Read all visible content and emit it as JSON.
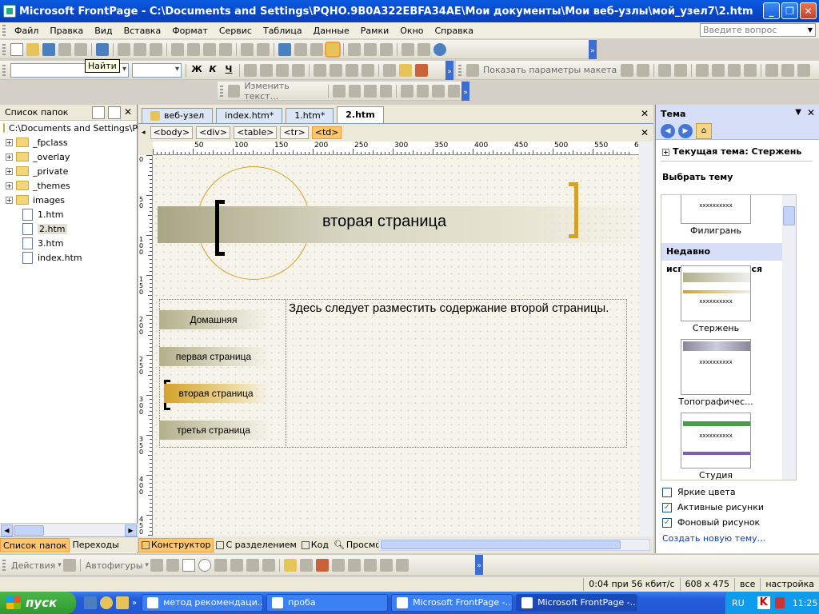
{
  "window": {
    "title": "Microsoft FrontPage - C:\\Documents and Settings\\PQHO.9B0A322EBFA34AE\\Мои документы\\Мои веб-узлы\\мой_узел7\\2.htm"
  },
  "menu": [
    "Файл",
    "Правка",
    "Вид",
    "Вставка",
    "Формат",
    "Сервис",
    "Таблица",
    "Данные",
    "Рамки",
    "Окно",
    "Справка"
  ],
  "ask_placeholder": "Введите вопрос",
  "tooltip": "Найти",
  "toolbar": {
    "bold": "Ж",
    "italic": "К",
    "underline": "Ч",
    "show_layout": "Показать параметры макета",
    "edit_text": "Изменить текст..."
  },
  "folder_list": {
    "title": "Список папок",
    "root": "C:\\Documents and Settings\\PQ",
    "folders": [
      "_fpclass",
      "_overlay",
      "_private",
      "_themes",
      "images"
    ],
    "files": [
      "1.htm",
      "2.htm",
      "3.htm",
      "index.htm"
    ],
    "selected": "2.htm"
  },
  "left_tabs": {
    "folders": "Список папок",
    "navigation": "Переходы"
  },
  "doc_tabs": [
    "веб-узел",
    "index.htm*",
    "1.htm*",
    "2.htm"
  ],
  "active_doc": "2.htm",
  "quick_tags": [
    "<body>",
    "<div>",
    "<table>",
    "<tr>",
    "<td>"
  ],
  "ruler_labels": [
    "50",
    "100",
    "150",
    "200",
    "250",
    "300",
    "350",
    "400",
    "450",
    "500",
    "550",
    "60"
  ],
  "vruler_labels": [
    "0",
    "5 0",
    "1 0 0",
    "1 5 0",
    "2 0 0",
    "2 5 0",
    "3 0 0",
    "3 5 0",
    "4 0 0",
    "4 5 0"
  ],
  "page": {
    "banner": "вторая страница",
    "nav": [
      "Домашняя",
      "первая страница",
      "вторая страница",
      "третья страница"
    ],
    "nav_active_index": 2,
    "body_text": "Здесь следует разместить содержание второй страницы."
  },
  "view_tabs": {
    "design": "Конструктор",
    "split": "С разделением",
    "code": "Код",
    "preview": "Просмотр"
  },
  "theme_pane": {
    "title": "Тема",
    "current_theme": "Текущая тема: Стержень",
    "select_theme": "Выбрать тему",
    "filigree": "Филигрань",
    "recent_header": "Недавно использовавшиеся",
    "themes": [
      "Стержень",
      "Топографичес...",
      "Студия"
    ],
    "thumb_placeholder": "xxxxxxxxxx",
    "options": [
      {
        "label": "Яркие цвета",
        "checked": false
      },
      {
        "label": "Активные рисунки",
        "checked": true
      },
      {
        "label": "Фоновый рисунок",
        "checked": true
      }
    ],
    "create_new": "Создать новую тему..."
  },
  "drawing": {
    "actions": "Действия",
    "autoshapes": "Автофигуры"
  },
  "status": {
    "speed": "0:04 при 56 кбит/с",
    "size": "608 x 475",
    "mode": "все",
    "custom": "настройка"
  },
  "taskbar": {
    "start": "пуск",
    "tasks": [
      "метод рекомендаци...",
      "проба",
      "Microsoft FrontPage -...",
      "Microsoft FrontPage -..."
    ],
    "active_task": 3,
    "lang": "RU",
    "clock": "11:25"
  },
  "colors": {
    "accent_orange": "#ffc66d",
    "theme_gold": "#d3a22b",
    "xp_blue": "#0846c9"
  }
}
